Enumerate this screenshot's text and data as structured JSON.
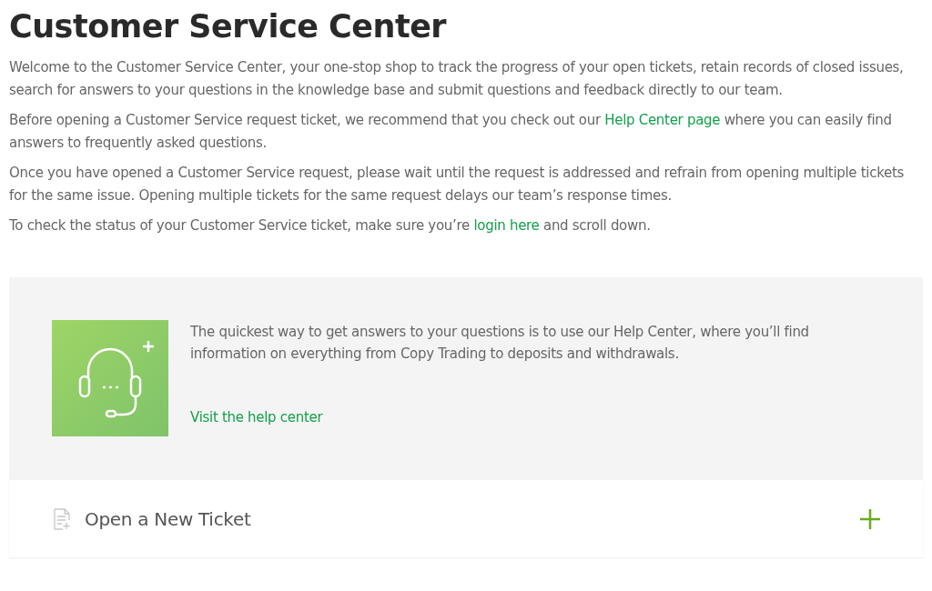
{
  "title": "Customer Service Center",
  "paragraphs": [
    [
      {
        "kind": "text",
        "text": "Welcome to the Customer Service Center, your one-stop shop to track the progress of your open tickets, retain records of closed issues, search for answers to your questions in the knowledge base and submit questions and feedback directly to our team."
      }
    ],
    [
      {
        "kind": "text",
        "text": "Before opening a Customer Service request ticket, we recommend that you check out our "
      },
      {
        "kind": "link",
        "text": "Help Center page"
      },
      {
        "kind": "text",
        "text": " where you can easily find answers to frequently asked questions."
      }
    ],
    [
      {
        "kind": "text",
        "text": "Once you have opened a Customer Service request, please wait until the request is addressed and refrain from opening multiple tickets for the same issue. Opening multiple tickets for the same request delays our team’s response times."
      }
    ],
    [
      {
        "kind": "text",
        "text": "To check the status of your Customer Service ticket, make sure you’re "
      },
      {
        "kind": "link",
        "text": "login here"
      },
      {
        "kind": "text",
        "text": " and scroll down."
      }
    ]
  ],
  "help_card": {
    "text": "The quickest way to get answers to your questions is to use our Help Center, where you’ll find information on everything from Copy Trading to deposits and withdrawals.",
    "link": "Visit the help center"
  },
  "accordion": {
    "label": "Open a New Ticket",
    "expanded": false
  }
}
